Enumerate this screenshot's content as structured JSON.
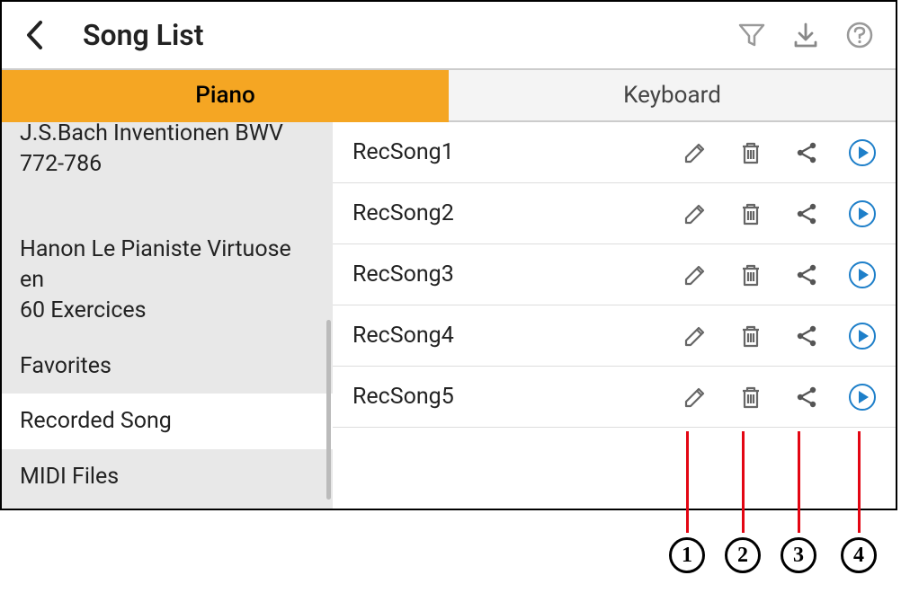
{
  "header": {
    "title": "Song List"
  },
  "tabs": [
    {
      "label": "Piano",
      "active": true
    },
    {
      "label": "Keyboard",
      "active": false
    }
  ],
  "sidebar": {
    "items": [
      {
        "label": "J.S.Bach Inventionen BWV 772-786",
        "cutoff": true
      },
      {
        "label": "Hanon Le Pianiste Virtuose en\n60 Exercices"
      },
      {
        "label": "Favorites"
      },
      {
        "label": "Recorded Song",
        "selected": true
      },
      {
        "label": "MIDI Files"
      }
    ]
  },
  "songs": [
    {
      "name": "RecSong1"
    },
    {
      "name": "RecSong2"
    },
    {
      "name": "RecSong3"
    },
    {
      "name": "RecSong4"
    },
    {
      "name": "RecSong5"
    }
  ],
  "callouts": [
    "1",
    "2",
    "3",
    "4"
  ]
}
